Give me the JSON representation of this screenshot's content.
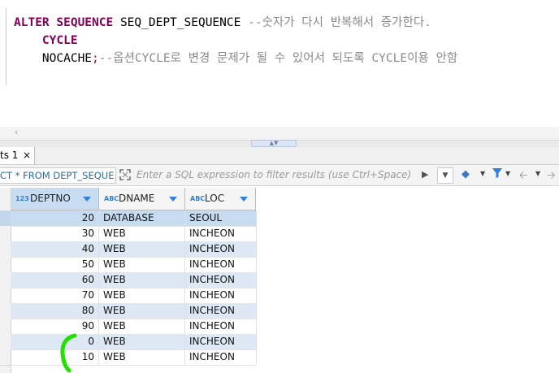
{
  "editor": {
    "lines": [
      {
        "keyword": "ALTER SEQUENCE",
        "rest": " SEQ_DEPT_SEQUENCE ",
        "comment": "--숫자가 다시 반복해서 증가한다."
      },
      {
        "indent": "    ",
        "keyword": "CYCLE"
      },
      {
        "indent": "    ",
        "plain": "NOCACHE",
        "separator": ";",
        "comment": "--옵션CYCLE로 변경 문제가 될 수 있어서 되도록 CYCLE이용 안함"
      }
    ]
  },
  "results_tab": {
    "label": "ts 1",
    "close": "×"
  },
  "filter_bar": {
    "sql_text": "CT * FROM DEPT_SEQUEN",
    "filter_placeholder": "Enter a SQL expression to filter results (use Ctrl+Space)"
  },
  "grid": {
    "columns": [
      {
        "type_badge": "123",
        "name": "DEPTNO"
      },
      {
        "type_badge": "ABC",
        "name": "DNAME"
      },
      {
        "type_badge": "ABC",
        "name": "LOC"
      }
    ],
    "rows": [
      {
        "deptno": "20",
        "dname": "DATABASE",
        "loc": "SEOUL"
      },
      {
        "deptno": "30",
        "dname": "WEB",
        "loc": "INCHEON"
      },
      {
        "deptno": "40",
        "dname": "WEB",
        "loc": "INCHEON"
      },
      {
        "deptno": "50",
        "dname": "WEB",
        "loc": "INCHEON"
      },
      {
        "deptno": "60",
        "dname": "WEB",
        "loc": "INCHEON"
      },
      {
        "deptno": "70",
        "dname": "WEB",
        "loc": "INCHEON"
      },
      {
        "deptno": "80",
        "dname": "WEB",
        "loc": "INCHEON"
      },
      {
        "deptno": "90",
        "dname": "WEB",
        "loc": "INCHEON"
      },
      {
        "deptno": "0",
        "dname": "WEB",
        "loc": "INCHEON"
      },
      {
        "deptno": "10",
        "dname": "WEB",
        "loc": "INCHEON"
      }
    ]
  },
  "colors": {
    "keyword": "#7f0055",
    "comment": "#8a8a8a",
    "selection": "#c7dcf1",
    "annotation": "#22e000"
  },
  "icons": {
    "expand": "expand-icon",
    "run": "play-icon",
    "eraser": "eraser-icon",
    "filter": "funnel-icon",
    "back": "arrow-left-icon",
    "forward": "arrow-right-icon"
  }
}
